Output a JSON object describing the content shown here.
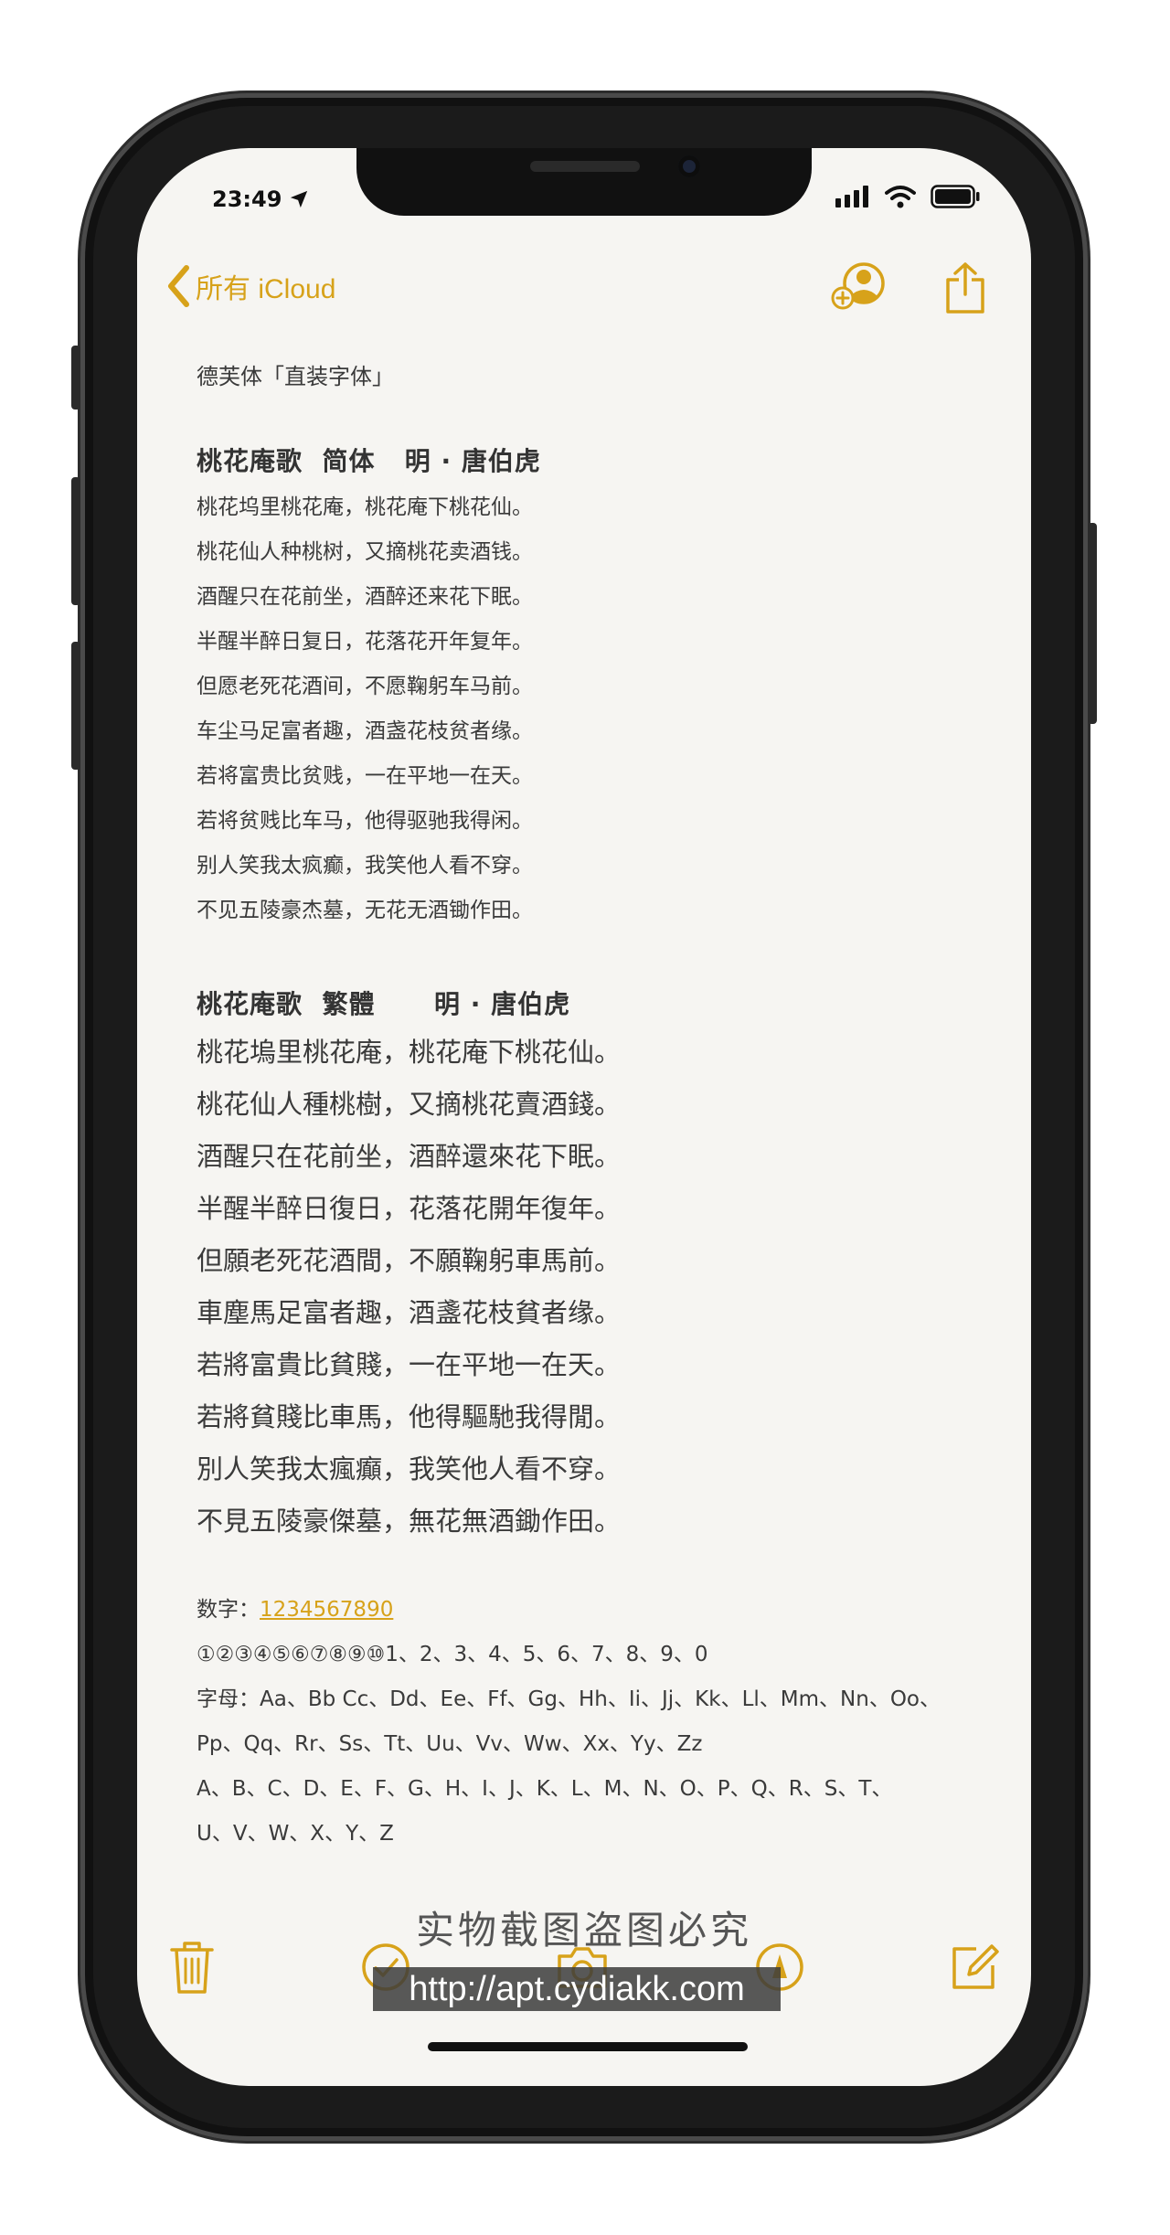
{
  "status_bar": {
    "time": "23:49"
  },
  "nav": {
    "back_label": "所有 iCloud"
  },
  "note": {
    "title": "德芙体「直装字体」",
    "simplified": {
      "heading": "桃花庵歌  简体   明 · 唐伯虎",
      "lines": [
        "桃花坞里桃花庵，桃花庵下桃花仙。",
        "桃花仙人种桃树，又摘桃花卖酒钱。",
        "酒醒只在花前坐，酒醉还来花下眠。",
        "半醒半醉日复日，花落花开年复年。",
        "但愿老死花酒间，不愿鞠躬车马前。",
        "车尘马足富者趣，酒盏花枝贫者缘。",
        "若将富贵比贫贱，一在平地一在天。",
        "若将贫贱比车马，他得驱驰我得闲。",
        "别人笑我太疯癫，我笑他人看不穿。",
        "不见五陵豪杰墓，无花无酒锄作田。"
      ]
    },
    "traditional": {
      "heading": "桃花庵歌  繁體      明 · 唐伯虎",
      "lines": [
        "桃花塢里桃花庵，桃花庵下桃花仙。",
        "桃花仙人種桃樹，又摘桃花賣酒錢。",
        "酒醒只在花前坐，酒醉還來花下眠。",
        "半醒半醉日復日，花落花開年復年。",
        "但願老死花酒間，不願鞠躬車馬前。",
        "車塵馬足富者趣，酒盞花枝貧者缘。",
        "若將富貴比貧賤，一在平地一在天。",
        "若將貧賤比車馬，他得驅馳我得閒。",
        "別人笑我太瘋癲，我笑他人看不穿。",
        "不見五陵豪傑墓，無花無酒鋤作田。"
      ]
    },
    "misc": {
      "digits_label": "数字：",
      "digits_link": "1234567890",
      "numbers_line": "①②③④⑤⑥⑦⑧⑨⑩1、2、3、4、5、6、7、8、9、0",
      "letters_line1": "字母：Aa、Bb Cc、Dd、Ee、Ff、Gg、Hh、Ii、Jj、Kk、Ll、Mm、Nn、Oo、",
      "letters_line2": "Pp、Qq、Rr、Ss、Tt、Uu、Vv、Ww、Xx、Yy、Zz",
      "upper_line1": "A、B、C、D、E、F、G、H、I、J、K、L、M、N、O、P、Q、R、S、T、",
      "upper_line2": "U、V、W、X、Y、Z"
    }
  },
  "watermark": {
    "text": "实物截图盗图必究",
    "url": "http://apt.cydiakk.com"
  },
  "colors": {
    "accent": "#d7a21a",
    "paper": "#f6f5f2",
    "text": "#3a3a3a"
  }
}
